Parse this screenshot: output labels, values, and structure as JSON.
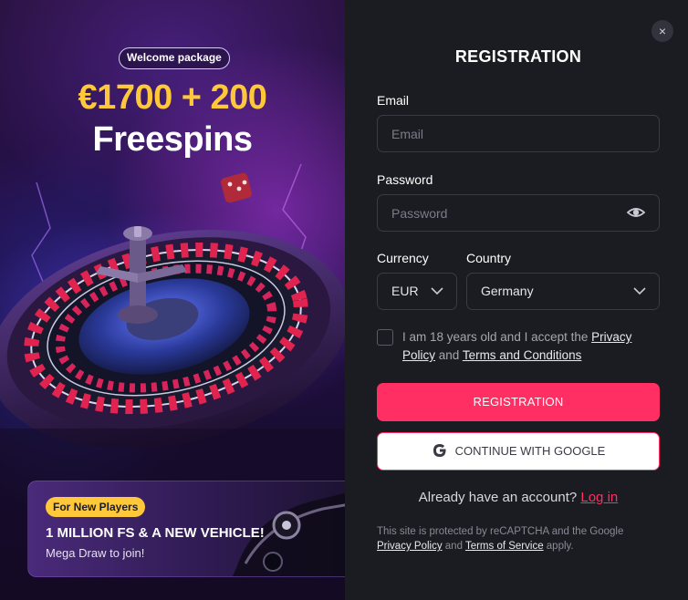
{
  "promo": {
    "badge": "Welcome package",
    "amount": "€1700 + 200",
    "subtitle": "Freespins",
    "card": {
      "pill": "For New Players",
      "title": "1 MILLION FS & A NEW VEHICLE!",
      "subtitle": "Mega Draw to join!"
    }
  },
  "form": {
    "close_icon": "×",
    "title": "REGISTRATION",
    "email": {
      "label": "Email",
      "placeholder": "Email"
    },
    "password": {
      "label": "Password",
      "placeholder": "Password"
    },
    "currency": {
      "label": "Currency",
      "value": "EUR"
    },
    "country": {
      "label": "Country",
      "value": "Germany"
    },
    "consent": {
      "text_before": "I am 18 years old and I accept the ",
      "privacy_link": "Privacy Policy",
      "text_and": " and ",
      "terms_link": "Terms and Conditions"
    },
    "register_button": "REGISTRATION",
    "google_button": "CONTINUE WITH GOOGLE",
    "account": {
      "question": "Already have an account? ",
      "login_link": "Log in"
    },
    "recaptcha": {
      "text_before": "This site is protected by reCAPTCHA and the Google ",
      "privacy_link": "Privacy Policy",
      "text_and": " and ",
      "terms_link": "Terms of Service",
      "text_after": " apply."
    }
  },
  "colors": {
    "accent": "#ff2e63",
    "gold": "#ffc83a",
    "panel_bg": "#1b1b22",
    "field_border": "#3b3b46"
  },
  "icons": [
    "close-icon",
    "eye-icon",
    "chevron-down-icon",
    "google-icon",
    "roulette-wheel-illustration",
    "dice-illustration"
  ]
}
